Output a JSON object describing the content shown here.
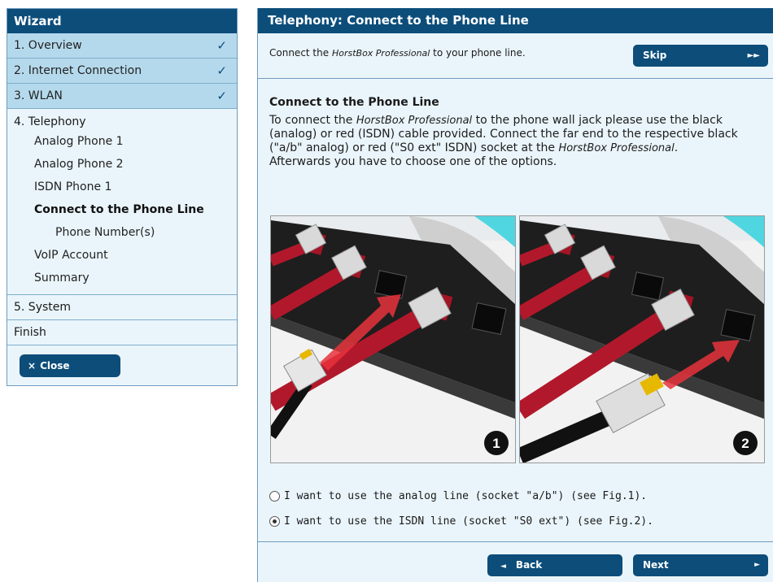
{
  "sidebar": {
    "title": "Wizard",
    "completed_steps": [
      {
        "label": "1. Overview",
        "check": "✓"
      },
      {
        "label": "2. Internet Connection",
        "check": "✓"
      },
      {
        "label": "3. WLAN",
        "check": "✓"
      }
    ],
    "current_step": {
      "label": "4. Telephony",
      "items": [
        "Analog Phone 1",
        "Analog Phone 2",
        "ISDN Phone 1",
        "Connect to the Phone Line",
        "Phone Number(s)",
        "VoIP Account",
        "Summary"
      ],
      "active_item": "Connect to the Phone Line"
    },
    "system_label": "5. System",
    "finish_label": "Finish",
    "close_label": "Close",
    "close_icon": "×"
  },
  "main": {
    "header": "Telephony: Connect to the Phone Line",
    "intro_pre": "Connect the ",
    "intro_product": "HorstBox Professional",
    "intro_post": " to your phone line.",
    "skip_label": "Skip",
    "skip_icon": "►►",
    "section_title": "Connect to the Phone Line",
    "desc_1": "To connect the ",
    "desc_product_1": "HorstBox Professional",
    "desc_2": " to the phone wall jack please use the black (analog) or red (ISDN) cable provided. Connect the far end to the respective black (\"a/b\" analog) or red (\"S0 ext\" ISDN) socket at the ",
    "desc_product_2": "HorstBox Professional",
    "desc_3": ".",
    "desc_4": "Afterwards you have to choose one of the options.",
    "figure_1_number": "1",
    "figure_2_number": "2",
    "options": [
      {
        "label": "I want to use the analog line (socket \"a/b\") (see Fig.1).",
        "selected": false
      },
      {
        "label": "I want to use the ISDN line (socket \"S0 ext\") (see Fig.2).",
        "selected": true
      }
    ],
    "back_label": "Back",
    "next_label": "Next",
    "back_icon": "◄",
    "next_icon": "►"
  },
  "colors": {
    "accent": "#0c4d7a",
    "panel_bg": "#eaf5fb",
    "step_done_bg": "#b5d9ec",
    "cable_red": "#b2182b",
    "cable_black": "#111111"
  }
}
